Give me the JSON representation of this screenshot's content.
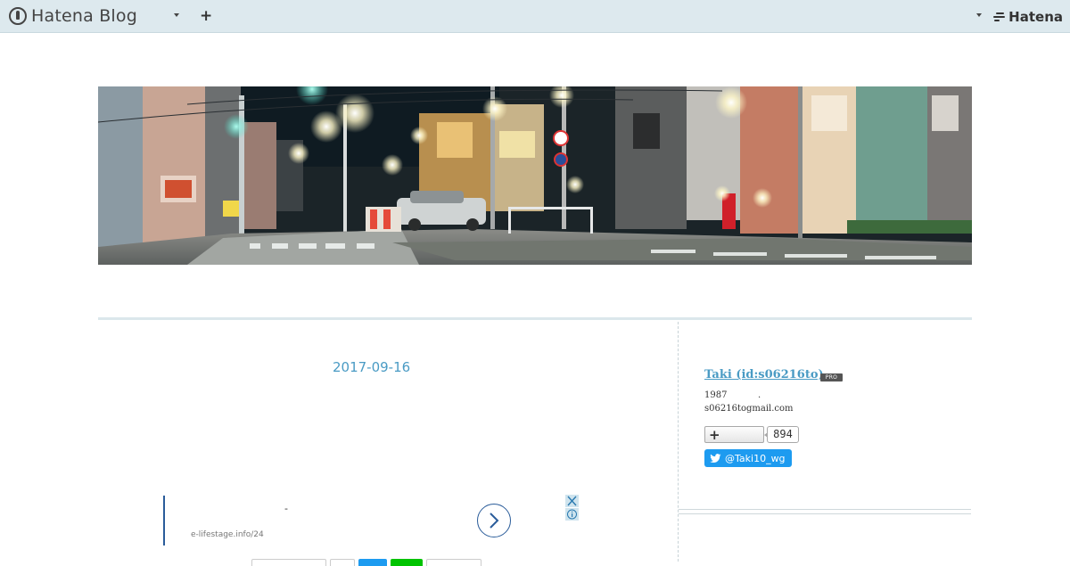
{
  "topbar": {
    "brand": "Hatena Blog",
    "add_label": "+",
    "hatena_label": "Hatena",
    "icons": [
      "hatena-blog-logo-icon",
      "chevron-down-icon",
      "plus-icon",
      "hatena-logo-icon"
    ]
  },
  "header_image": {
    "alt": "",
    "colors": {
      "sky": "#1b2428",
      "teal_light": "#48e0c8",
      "road": "#6b7070"
    }
  },
  "entry": {
    "date": "2017-09-16"
  },
  "ad": {
    "dash": "-",
    "url": "e-lifestage.info/24",
    "icons": [
      "chevron-right-icon",
      "close-icon",
      "info-icon"
    ]
  },
  "sidebar": {
    "profile_name": "Taki (id:s06216to)",
    "pro_badge": "PRO",
    "line1": "1987",
    "dot": ".",
    "line2": "s06216togmail.com",
    "follow_count": "894",
    "twitter_handle": "@Taki10_wg"
  },
  "colors": {
    "topbar_bg": "#dde9ee",
    "link": "#4a9bc4",
    "twitter": "#1d9bf0",
    "ad_accent": "#2a5c9a"
  }
}
